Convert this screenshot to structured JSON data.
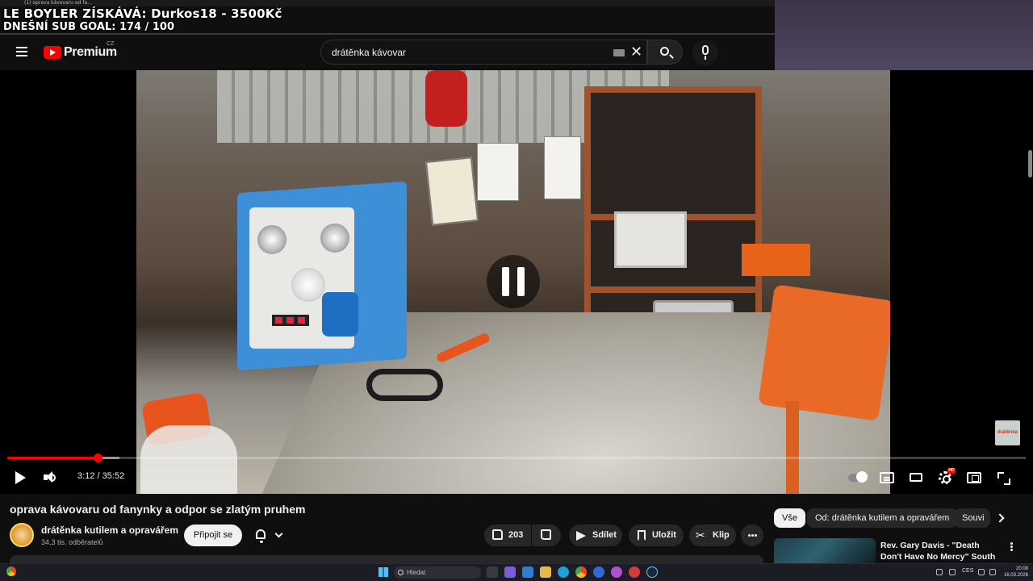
{
  "stream_overlay": {
    "line1": "LE BOYLER ZÍSKÁVÁ: Durkos18 - 3500Kč",
    "line2": "DNEŠNÍ SUB GOAL: 174 / 100"
  },
  "browser_tab": {
    "title": "(1) oprava kávovaru od fa..."
  },
  "header": {
    "logo_text": "Premium",
    "logo_region": "CZ",
    "search_value": "drátěnka kávovar",
    "icons": [
      "menu-icon",
      "youtube-logo-icon",
      "keyboard-icon",
      "close-icon",
      "search-icon",
      "microphone-icon"
    ]
  },
  "player": {
    "current_time": "3:12",
    "duration": "35:52",
    "time_display": "3:12 / 35:52",
    "progress_fraction": 0.089,
    "buffered_fraction": 0.11,
    "state": "paused-overlay",
    "watermark_text": "drátěnka",
    "accent_color": "#ff0000",
    "settings_badge": "HD",
    "icons": [
      "play-icon",
      "volume-icon",
      "pause-icon",
      "autoplay-toggle-icon",
      "subtitles-icon",
      "loop-icon",
      "settings-icon",
      "miniplayer-icon",
      "fullscreen-icon"
    ]
  },
  "video": {
    "title": "oprava kávovaru od fanynky a odpor se zlatým pruhem",
    "channel_name": "drátěnka kutilem a opravářem",
    "subscribers": "34,3 tis. odběratelů",
    "join_label": "Připojit se",
    "likes": "203",
    "share_label": "Sdílet",
    "save_label": "Uložit",
    "clip_label": "Klip"
  },
  "sidebar": {
    "chips": [
      "Vše",
      "Od: drátěnka kutilem a opravářem",
      "Souvi"
    ],
    "recommendation": {
      "title": "Rev. Gary Davis - \"Death Don't Have No Mercy\" South of ..."
    }
  },
  "taskbar": {
    "search_placeholder": "Hledat",
    "language": "CES",
    "time": "20:08",
    "date": "16.03.2026"
  }
}
